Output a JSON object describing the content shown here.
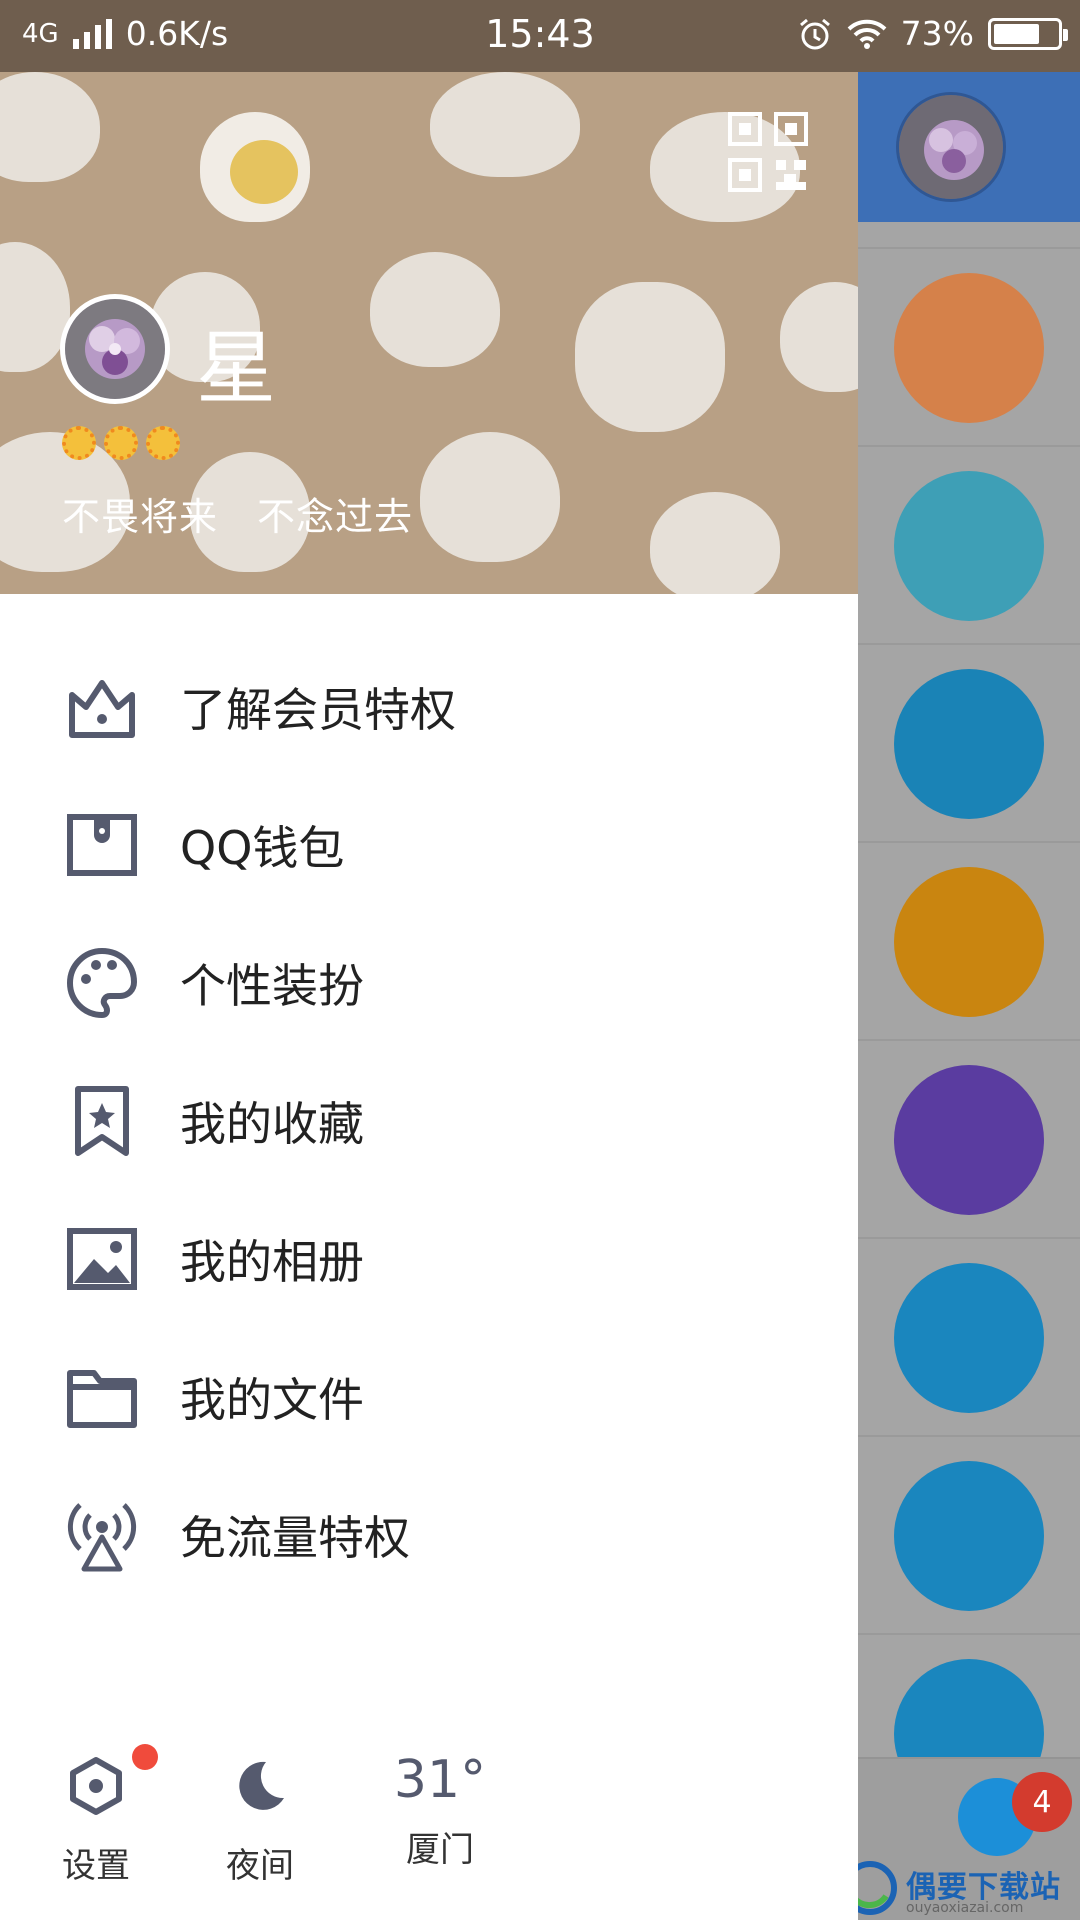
{
  "status_bar": {
    "network": "4G",
    "speed": "0.6K/s",
    "time": "15:43",
    "battery": "73%",
    "battery_level": 0.73
  },
  "profile": {
    "nickname": "星",
    "signature": "不畏将来　不念过去",
    "level_icons": [
      "sun-icon",
      "sun-icon",
      "sun-icon"
    ]
  },
  "menu": [
    {
      "label": "了解会员特权",
      "icon": "crown-icon"
    },
    {
      "label": "QQ钱包",
      "icon": "wallet-icon"
    },
    {
      "label": "个性装扮",
      "icon": "palette-icon"
    },
    {
      "label": "我的收藏",
      "icon": "bookmark-star-icon"
    },
    {
      "label": "我的相册",
      "icon": "photo-icon"
    },
    {
      "label": "我的文件",
      "icon": "folder-icon"
    },
    {
      "label": "免流量特权",
      "icon": "signal-tower-icon"
    }
  ],
  "footer": {
    "settings_label": "设置",
    "night_label": "夜间",
    "temperature": "31°",
    "city": "厦门"
  },
  "background_app": {
    "notification_count": "4",
    "row_colors": [
      "#d5814a",
      "#3e9fb6",
      "#1a83b6",
      "#c98510",
      "#5a3ca0",
      "#1a86be",
      "#1a86be",
      "#1a86be"
    ]
  },
  "watermark": {
    "title": "偶要下载站",
    "url": "ouyaoxiazai.com"
  },
  "colors": {
    "header_bg": "#b8a085",
    "status_bar_bg": "#6f5e4e",
    "icon_color": "#555a6e",
    "badge_red": "#f04b3c"
  }
}
